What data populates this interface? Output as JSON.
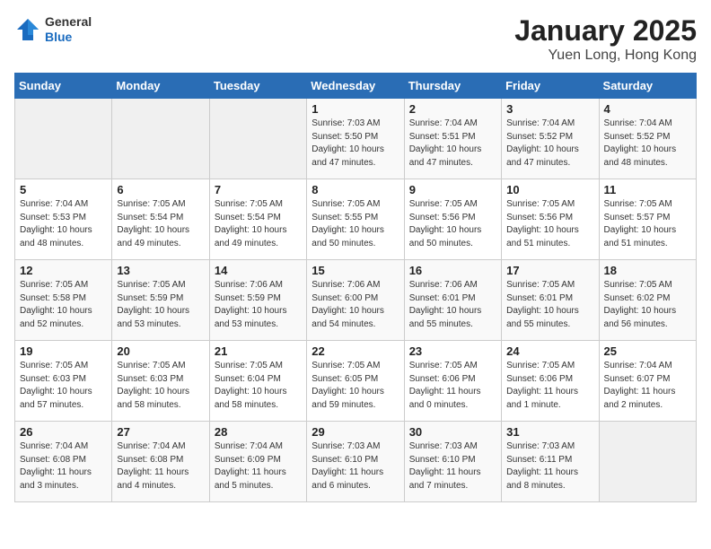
{
  "header": {
    "logo_general": "General",
    "logo_blue": "Blue",
    "title": "January 2025",
    "subtitle": "Yuen Long, Hong Kong"
  },
  "days_of_week": [
    "Sunday",
    "Monday",
    "Tuesday",
    "Wednesday",
    "Thursday",
    "Friday",
    "Saturday"
  ],
  "weeks": [
    [
      {
        "day": "",
        "sunrise": "",
        "sunset": "",
        "daylight": ""
      },
      {
        "day": "",
        "sunrise": "",
        "sunset": "",
        "daylight": ""
      },
      {
        "day": "",
        "sunrise": "",
        "sunset": "",
        "daylight": ""
      },
      {
        "day": "1",
        "sunrise": "7:03 AM",
        "sunset": "5:50 PM",
        "daylight": "10 hours and 47 minutes."
      },
      {
        "day": "2",
        "sunrise": "7:04 AM",
        "sunset": "5:51 PM",
        "daylight": "10 hours and 47 minutes."
      },
      {
        "day": "3",
        "sunrise": "7:04 AM",
        "sunset": "5:52 PM",
        "daylight": "10 hours and 47 minutes."
      },
      {
        "day": "4",
        "sunrise": "7:04 AM",
        "sunset": "5:52 PM",
        "daylight": "10 hours and 48 minutes."
      }
    ],
    [
      {
        "day": "5",
        "sunrise": "7:04 AM",
        "sunset": "5:53 PM",
        "daylight": "10 hours and 48 minutes."
      },
      {
        "day": "6",
        "sunrise": "7:05 AM",
        "sunset": "5:54 PM",
        "daylight": "10 hours and 49 minutes."
      },
      {
        "day": "7",
        "sunrise": "7:05 AM",
        "sunset": "5:54 PM",
        "daylight": "10 hours and 49 minutes."
      },
      {
        "day": "8",
        "sunrise": "7:05 AM",
        "sunset": "5:55 PM",
        "daylight": "10 hours and 50 minutes."
      },
      {
        "day": "9",
        "sunrise": "7:05 AM",
        "sunset": "5:56 PM",
        "daylight": "10 hours and 50 minutes."
      },
      {
        "day": "10",
        "sunrise": "7:05 AM",
        "sunset": "5:56 PM",
        "daylight": "10 hours and 51 minutes."
      },
      {
        "day": "11",
        "sunrise": "7:05 AM",
        "sunset": "5:57 PM",
        "daylight": "10 hours and 51 minutes."
      }
    ],
    [
      {
        "day": "12",
        "sunrise": "7:05 AM",
        "sunset": "5:58 PM",
        "daylight": "10 hours and 52 minutes."
      },
      {
        "day": "13",
        "sunrise": "7:05 AM",
        "sunset": "5:59 PM",
        "daylight": "10 hours and 53 minutes."
      },
      {
        "day": "14",
        "sunrise": "7:06 AM",
        "sunset": "5:59 PM",
        "daylight": "10 hours and 53 minutes."
      },
      {
        "day": "15",
        "sunrise": "7:06 AM",
        "sunset": "6:00 PM",
        "daylight": "10 hours and 54 minutes."
      },
      {
        "day": "16",
        "sunrise": "7:06 AM",
        "sunset": "6:01 PM",
        "daylight": "10 hours and 55 minutes."
      },
      {
        "day": "17",
        "sunrise": "7:05 AM",
        "sunset": "6:01 PM",
        "daylight": "10 hours and 55 minutes."
      },
      {
        "day": "18",
        "sunrise": "7:05 AM",
        "sunset": "6:02 PM",
        "daylight": "10 hours and 56 minutes."
      }
    ],
    [
      {
        "day": "19",
        "sunrise": "7:05 AM",
        "sunset": "6:03 PM",
        "daylight": "10 hours and 57 minutes."
      },
      {
        "day": "20",
        "sunrise": "7:05 AM",
        "sunset": "6:03 PM",
        "daylight": "10 hours and 58 minutes."
      },
      {
        "day": "21",
        "sunrise": "7:05 AM",
        "sunset": "6:04 PM",
        "daylight": "10 hours and 58 minutes."
      },
      {
        "day": "22",
        "sunrise": "7:05 AM",
        "sunset": "6:05 PM",
        "daylight": "10 hours and 59 minutes."
      },
      {
        "day": "23",
        "sunrise": "7:05 AM",
        "sunset": "6:06 PM",
        "daylight": "11 hours and 0 minutes."
      },
      {
        "day": "24",
        "sunrise": "7:05 AM",
        "sunset": "6:06 PM",
        "daylight": "11 hours and 1 minute."
      },
      {
        "day": "25",
        "sunrise": "7:04 AM",
        "sunset": "6:07 PM",
        "daylight": "11 hours and 2 minutes."
      }
    ],
    [
      {
        "day": "26",
        "sunrise": "7:04 AM",
        "sunset": "6:08 PM",
        "daylight": "11 hours and 3 minutes."
      },
      {
        "day": "27",
        "sunrise": "7:04 AM",
        "sunset": "6:08 PM",
        "daylight": "11 hours and 4 minutes."
      },
      {
        "day": "28",
        "sunrise": "7:04 AM",
        "sunset": "6:09 PM",
        "daylight": "11 hours and 5 minutes."
      },
      {
        "day": "29",
        "sunrise": "7:03 AM",
        "sunset": "6:10 PM",
        "daylight": "11 hours and 6 minutes."
      },
      {
        "day": "30",
        "sunrise": "7:03 AM",
        "sunset": "6:10 PM",
        "daylight": "11 hours and 7 minutes."
      },
      {
        "day": "31",
        "sunrise": "7:03 AM",
        "sunset": "6:11 PM",
        "daylight": "11 hours and 8 minutes."
      },
      {
        "day": "",
        "sunrise": "",
        "sunset": "",
        "daylight": ""
      }
    ]
  ]
}
